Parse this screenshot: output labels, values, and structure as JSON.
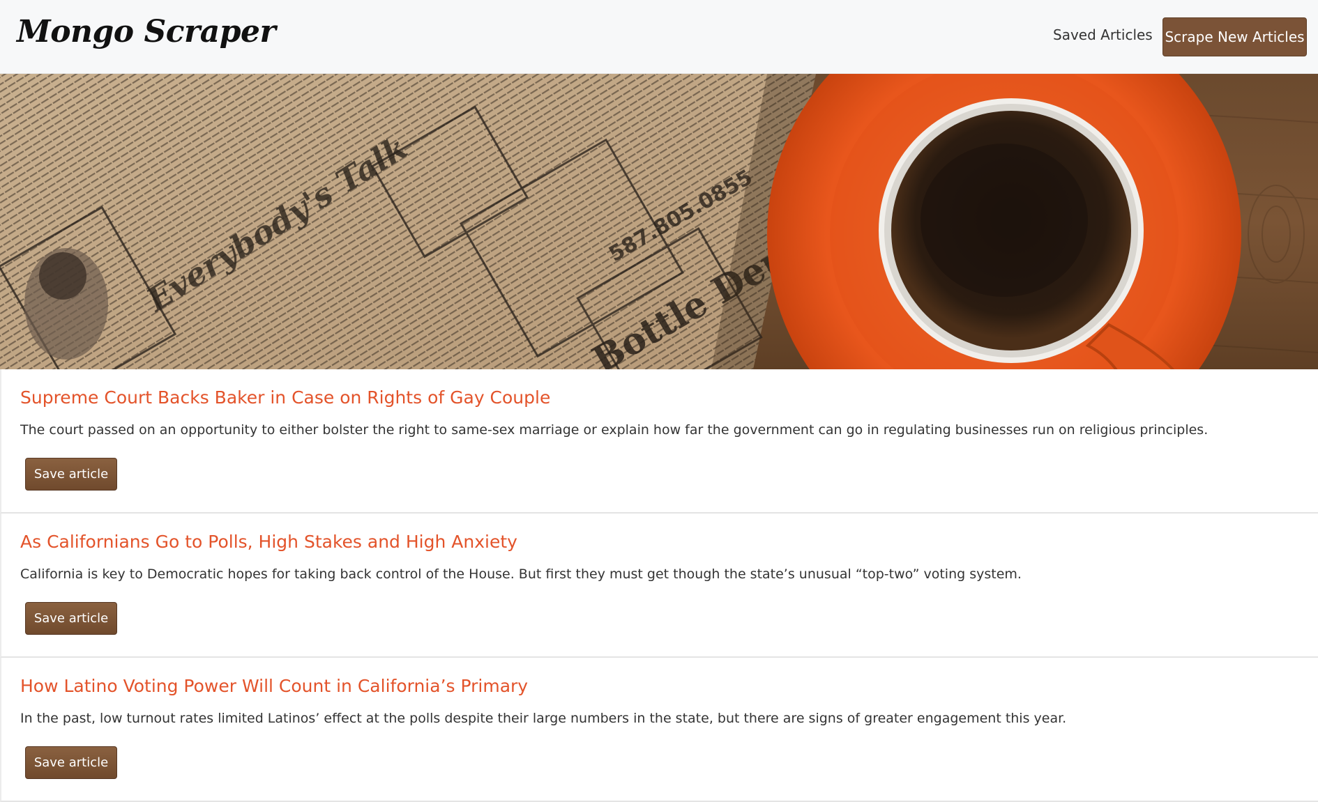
{
  "navbar": {
    "brand": "Mongo Scraper",
    "saved_link": "Saved Articles",
    "scrape_button": "Scrape New Articles"
  },
  "hero": {
    "image": "newspaper-and-coffee-cup-banner"
  },
  "colors": {
    "brand_brown": "#7b5337",
    "title_orange": "#e3532a",
    "navbar_bg": "#f7f8f9"
  },
  "articles": [
    {
      "title": "Supreme Court Backs Baker in Case on Rights of Gay Couple",
      "summary": "The court passed on an opportunity to either bolster the right to same-sex marriage or explain how far the government can go in regulating businesses run on religious principles.",
      "button": "Save article"
    },
    {
      "title": "As Californians Go to Polls, High Stakes and High Anxiety",
      "summary": "California is key to Democratic hopes for taking back control of the House. But first they must get though the state’s unusual “top-two” voting system.",
      "button": "Save article"
    },
    {
      "title": "How Latino Voting Power Will Count in California’s Primary",
      "summary": "In the past, low turnout rates limited Latinos’ effect at the polls despite their large numbers in the state, but there are signs of greater engagement this year.",
      "button": "Save article"
    }
  ]
}
